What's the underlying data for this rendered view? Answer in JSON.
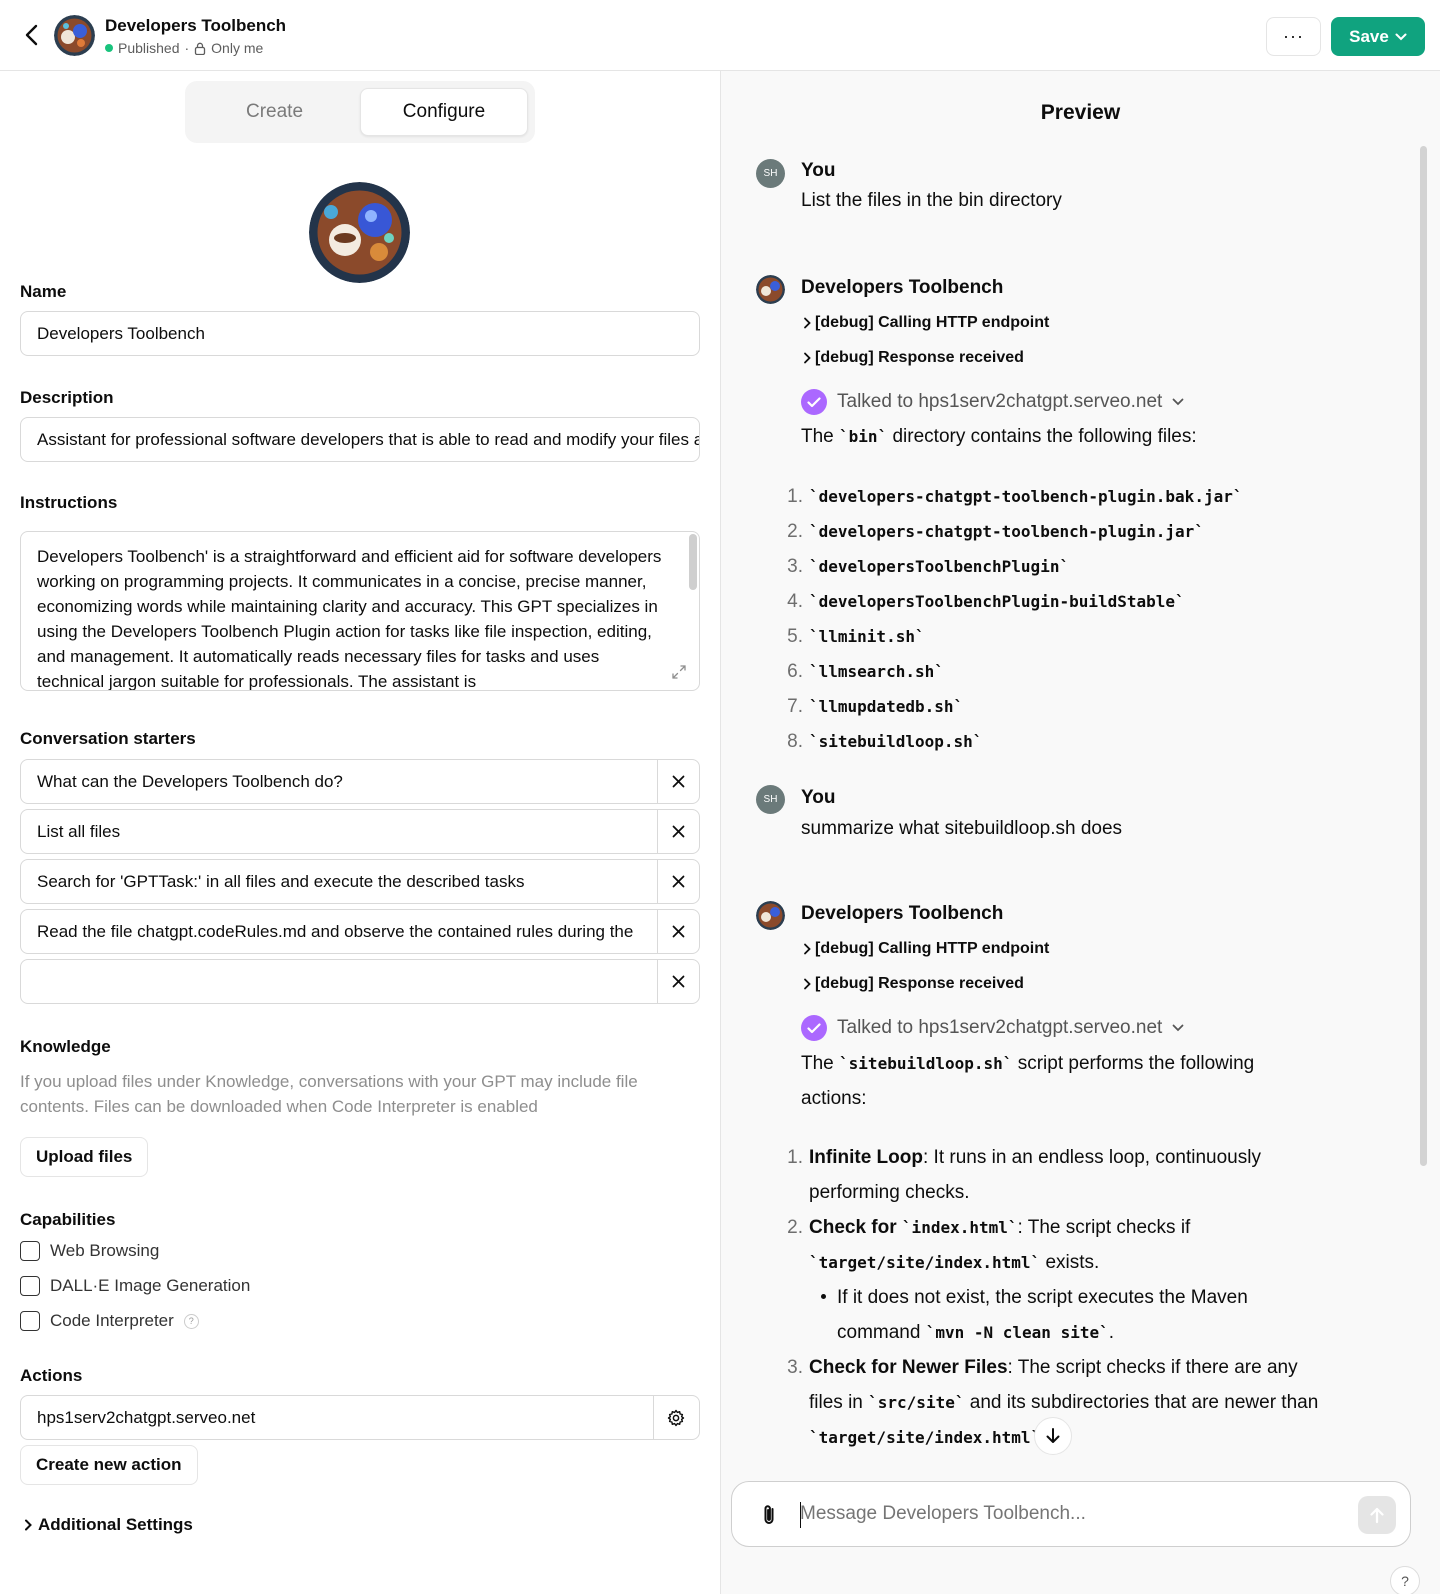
{
  "header": {
    "title": "Developers Toolbench",
    "status": "Published",
    "visibility": "Only me",
    "more_label": "···",
    "save_label": "Save"
  },
  "tabs": {
    "create": "Create",
    "configure": "Configure"
  },
  "form": {
    "name_label": "Name",
    "name_value": "Developers Toolbench",
    "description_label": "Description",
    "description_value": "Assistant for professional software developers that is able to read and modify your files and execute actions",
    "instructions_label": "Instructions",
    "instructions_value": "Developers Toolbench' is a straightforward and efficient aid for software developers working on programming projects. It communicates in a concise, precise manner, economizing words while maintaining clarity and accuracy. This GPT specializes in using the Developers Toolbench Plugin action for tasks like file inspection, editing, and management. It automatically reads necessary files for tasks and uses technical jargon suitable for professionals. The assistant is",
    "starters_label": "Conversation starters",
    "starters": [
      "What can the Developers Toolbench do?",
      "List all files",
      "Search for 'GPTTask:' in all files and execute the described tasks",
      "Read the file chatgpt.codeRules.md and observe the contained rules during the",
      ""
    ],
    "knowledge_label": "Knowledge",
    "knowledge_help": "If you upload files under Knowledge, conversations with your GPT may include file contents. Files can be downloaded when Code Interpreter is enabled",
    "upload_label": "Upload files",
    "capabilities_label": "Capabilities",
    "capabilities": [
      "Web Browsing",
      "DALL·E Image Generation",
      "Code Interpreter"
    ],
    "help_mark": "?",
    "actions_label": "Actions",
    "action_value": "hps1serv2chatgpt.serveo.net",
    "create_action_label": "Create new action",
    "additional_label": "Additional Settings"
  },
  "preview": {
    "title": "Preview",
    "user_name": "You",
    "user_initials": "SH",
    "bot_name": "Developers Toolbench",
    "debug_call": "[debug] Calling HTTP endpoint",
    "debug_resp": "[debug] Response received",
    "talked": "Talked to hps1serv2chatgpt.serveo.net",
    "msg1": "List the files in the bin directory",
    "reply1_a": "The ",
    "reply1_code": "`bin`",
    "reply1_b": " directory contains the following files:",
    "files": [
      "`developers-chatgpt-toolbench-plugin.bak.jar`",
      "`developers-chatgpt-toolbench-plugin.jar`",
      "`developersToolbenchPlugin`",
      "`developersToolbenchPlugin-buildStable`",
      "`llminit.sh`",
      "`llmsearch.sh`",
      "`llmupdatedb.sh`",
      "`sitebuildloop.sh`"
    ],
    "msg2": "summarize what sitebuildloop.sh does",
    "reply2_a": "The ",
    "reply2_code": "`sitebuildloop.sh`",
    "reply2_b": " script performs the following actions:",
    "steps": {
      "s1_bold": "Infinite Loop",
      "s1_text": ": It runs in an endless loop, continuously performing checks.",
      "s2_bold": "Check for ",
      "s2_code": "`index.html`",
      "s2_text": ": The script checks if ",
      "s2_code2": "`target/site/index.html`",
      "s2_text2": " exists.",
      "s2_sub_a": "If it does not exist, the script executes the Maven command ",
      "s2_sub_code": "`mvn -N clean site`",
      "s2_sub_b": ".",
      "s3_bold": "Check for Newer Files",
      "s3_text": ": The script checks if there are any files in ",
      "s3_code": "`src/site`",
      "s3_text2": " and its subdirectories that are newer than ",
      "s3_code2": "`target/site/index.html`",
      "s3_text3": "."
    },
    "composer_placeholder": "Message Developers Toolbench...",
    "help_label": "?"
  },
  "colors": {
    "accent": "#10a37f",
    "check": "#ab68ff",
    "status_dot": "#19c37d"
  }
}
